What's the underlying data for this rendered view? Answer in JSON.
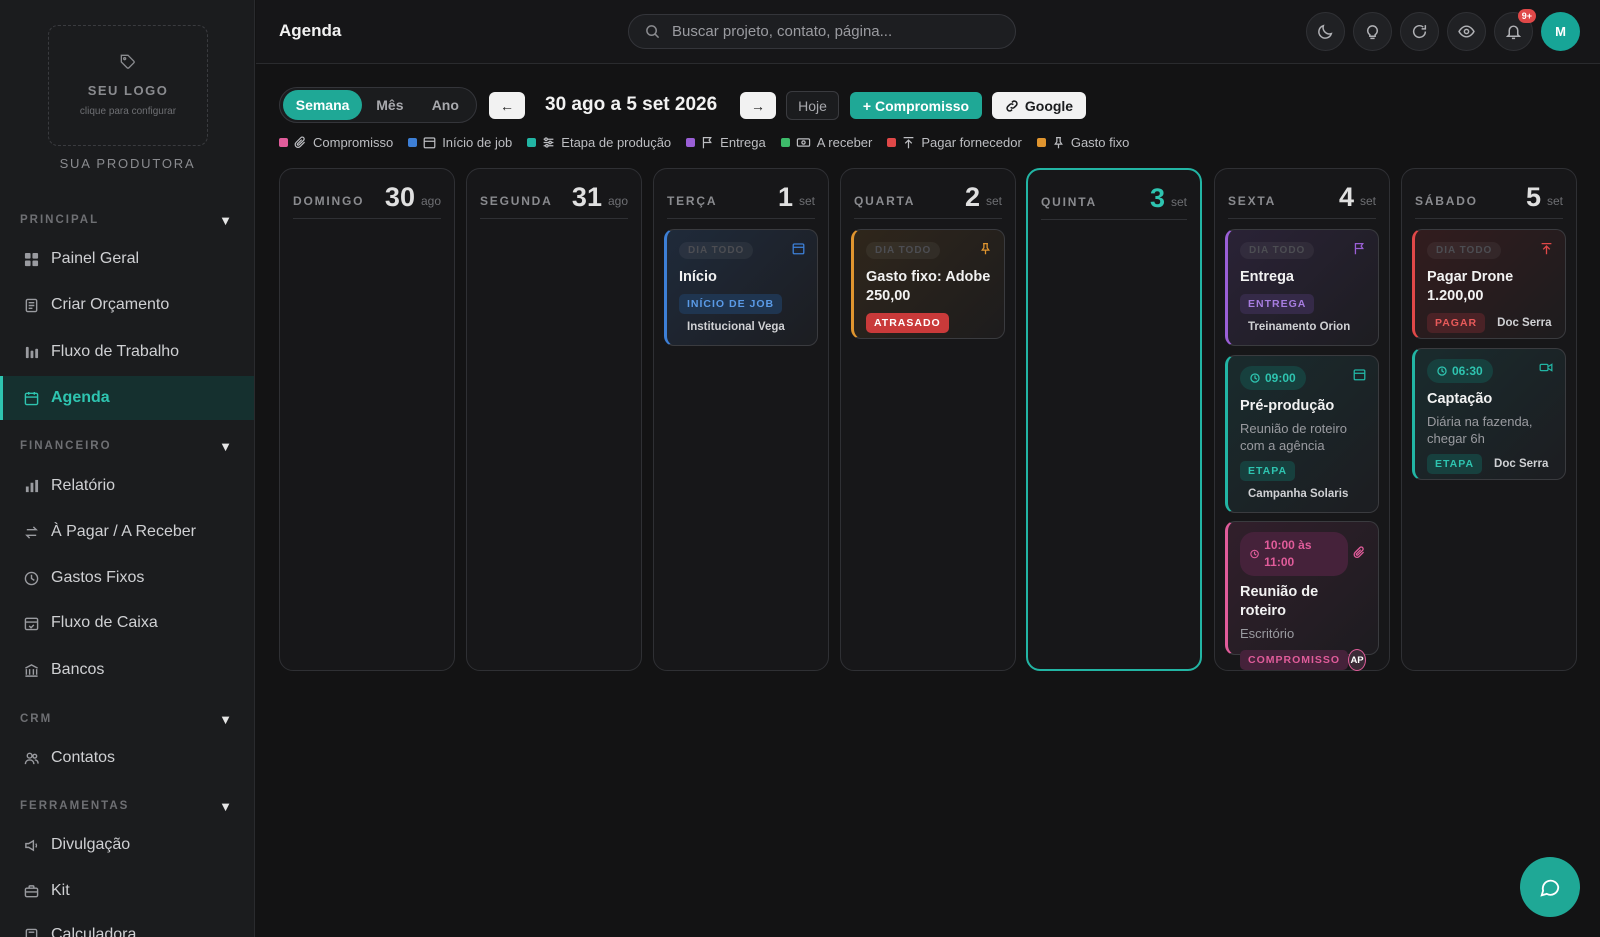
{
  "sidebar": {
    "logo_title": "SEU LOGO",
    "logo_sub": "clique para configurar",
    "producer": "SUA PRODUTORA",
    "caret": "▼",
    "sections": {
      "principal": "PRINCIPAL",
      "financeiro": "FINANCEIRO",
      "crm": "CRM",
      "ferramentas": "FERRAMENTAS"
    },
    "items": {
      "painel": "Painel Geral",
      "orcamento": "Criar Orçamento",
      "fluxo_trabalho": "Fluxo de Trabalho",
      "agenda": "Agenda",
      "relatorio": "Relatório",
      "pagar_receber": "À Pagar / A Receber",
      "gastos_fixos": "Gastos Fixos",
      "fluxo_caixa": "Fluxo de Caixa",
      "bancos": "Bancos",
      "contatos": "Contatos",
      "divulgacao": "Divulgação",
      "kit": "Kit",
      "calculadora": "Calculadora"
    }
  },
  "header": {
    "title": "Agenda",
    "search_placeholder": "Buscar projeto, contato, página...",
    "notif_badge": "9+",
    "avatar_initial": "M"
  },
  "toolbar": {
    "view_week": "Semana",
    "view_month": "Mês",
    "view_year": "Ano",
    "prev": "←",
    "next": "→",
    "range": "30 ago a 5 set 2026",
    "today": "Hoje",
    "add": "+ Compromisso",
    "google": "Google"
  },
  "legend": {
    "compromisso": "Compromisso",
    "inicio_job": "Início de job",
    "etapa": "Etapa de produção",
    "entrega": "Entrega",
    "a_receber": "A receber",
    "pagar": "Pagar fornecedor",
    "gasto_fixo": "Gasto fixo"
  },
  "colors": {
    "accent": "#1fa896",
    "compromisso": "#e05c9a",
    "inicio_job": "#3d7fd6",
    "etapa": "#22b5a4",
    "entrega": "#9a5fd6",
    "a_receber": "#3dbb6a",
    "pagar": "#e04848",
    "gasto_fixo": "#e0952f"
  },
  "days": [
    {
      "name": "DOMINGO",
      "num": "30",
      "month": "ago"
    },
    {
      "name": "SEGUNDA",
      "num": "31",
      "month": "ago"
    },
    {
      "name": "TERÇA",
      "num": "1",
      "month": "set"
    },
    {
      "name": "QUARTA",
      "num": "2",
      "month": "set"
    },
    {
      "name": "QUINTA",
      "num": "3",
      "month": "set"
    },
    {
      "name": "SEXTA",
      "num": "4",
      "month": "set"
    },
    {
      "name": "SÁBADO",
      "num": "5",
      "month": "set"
    }
  ],
  "events": {
    "inicio": {
      "allday": "DIA TODO",
      "title": "Início",
      "tag": "INÍCIO DE JOB",
      "project": "Institucional Vega"
    },
    "gasto": {
      "allday": "DIA TODO",
      "title": "Gasto fixo: Adobe 250,00",
      "tag": "ATRASADO"
    },
    "entrega": {
      "allday": "DIA TODO",
      "title": "Entrega",
      "tag": "ENTREGA",
      "project": "Treinamento Orion"
    },
    "preprod": {
      "time": "09:00",
      "title": "Pré-produção",
      "desc": "Reunião de roteiro com a agência",
      "tag": "ETAPA",
      "project": "Campanha Solaris"
    },
    "reuniao": {
      "time": "10:00 às 11:00",
      "title": "Reunião de roteiro",
      "desc": "Escritório",
      "tag": "COMPROMISSO",
      "initials": "AP"
    },
    "drone": {
      "allday": "DIA TODO",
      "title": "Pagar Drone 1.200,00",
      "tag": "PAGAR",
      "project": "Doc Serra"
    },
    "captacao": {
      "time": "06:30",
      "title": "Captação",
      "desc": "Diária na fazenda, chegar 6h",
      "tag": "ETAPA",
      "project": "Doc Serra"
    }
  }
}
